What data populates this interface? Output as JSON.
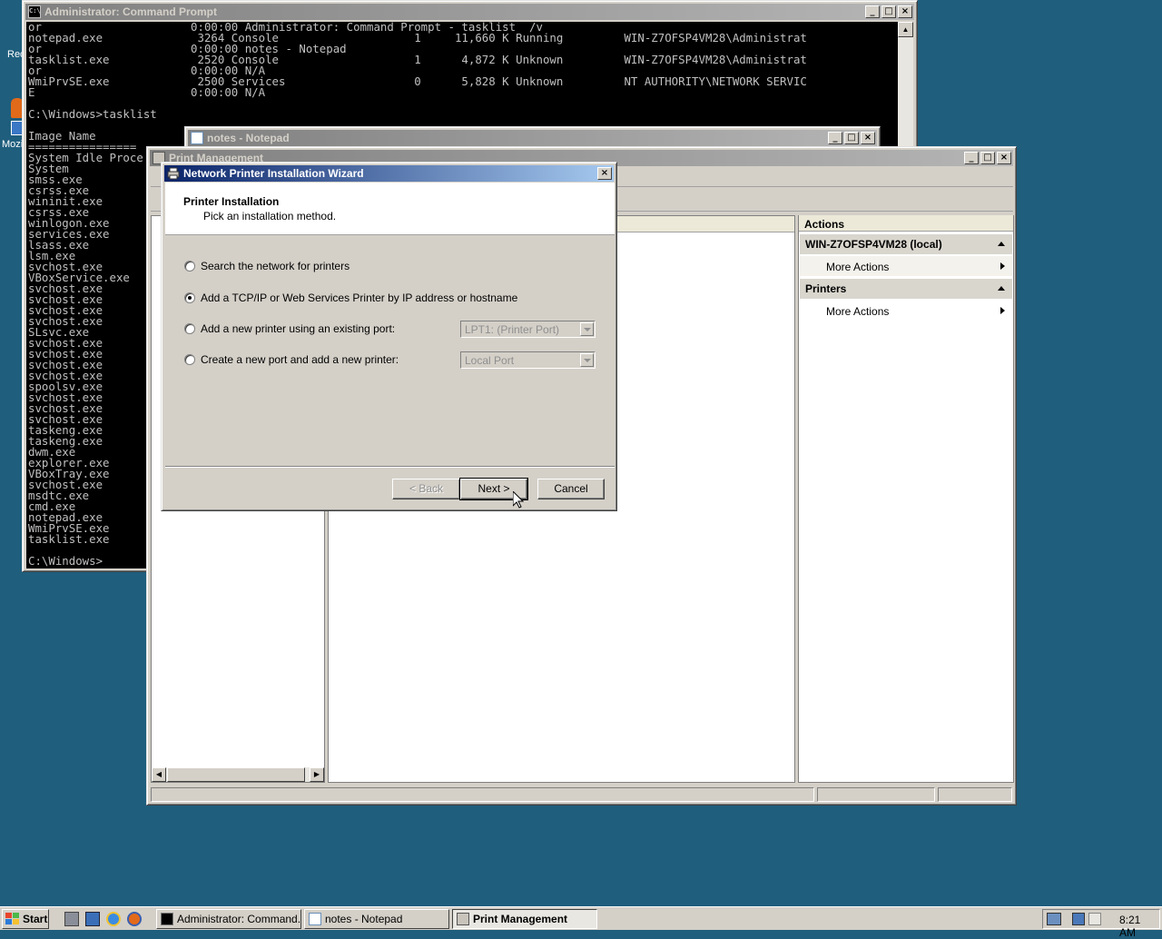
{
  "cmd": {
    "title": "Administrator: Command Prompt",
    "lines": [
      "or                      0:00:00 Administrator: Command Prompt - tasklist  /v",
      "notepad.exe              3264 Console                    1     11,660 K Running         WIN-Z7OFSP4VM28\\Administrat",
      "or                      0:00:00 notes - Notepad",
      "tasklist.exe             2520 Console                    1      4,872 K Unknown         WIN-Z7OFSP4VM28\\Administrat",
      "or                      0:00:00 N/A",
      "WmiPrvSE.exe             2500 Services                   0      5,828 K Unknown         NT AUTHORITY\\NETWORK SERVIC",
      "E                       0:00:00 N/A",
      "",
      "C:\\Windows>tasklist",
      "",
      "Image Name",
      "================",
      "System Idle Proce",
      "System",
      "smss.exe",
      "csrss.exe",
      "wininit.exe",
      "csrss.exe",
      "winlogon.exe",
      "services.exe",
      "lsass.exe",
      "lsm.exe",
      "svchost.exe",
      "VBoxService.exe",
      "svchost.exe",
      "svchost.exe",
      "svchost.exe",
      "svchost.exe",
      "SLsvc.exe",
      "svchost.exe",
      "svchost.exe",
      "svchost.exe",
      "svchost.exe",
      "spoolsv.exe",
      "svchost.exe",
      "svchost.exe",
      "svchost.exe",
      "taskeng.exe",
      "taskeng.exe",
      "dwm.exe",
      "explorer.exe",
      "VBoxTray.exe",
      "svchost.exe",
      "msdtc.exe",
      "cmd.exe",
      "notepad.exe",
      "WmiPrvSE.exe",
      "tasklist.exe",
      "",
      "C:\\Windows>"
    ]
  },
  "notepad": {
    "title": "notes - Notepad"
  },
  "print_management": {
    "title": "Print Management",
    "actions_header": "Actions",
    "sections": [
      {
        "label": "WIN-Z7OFSP4VM28 (local)",
        "item": "More Actions"
      },
      {
        "label": "Printers",
        "item": "More Actions"
      }
    ]
  },
  "wizard": {
    "title": "Network Printer Installation Wizard",
    "heading": "Printer Installation",
    "subheading": "Pick an installation method.",
    "options": [
      {
        "label": "Search the network for printers",
        "selected": false
      },
      {
        "label": "Add a TCP/IP or Web Services Printer by IP address or hostname",
        "selected": true
      },
      {
        "label": "Add a new printer using an existing port:",
        "selected": false,
        "combo": "LPT1: (Printer Port)"
      },
      {
        "label": "Create a new port and add a new printer:",
        "selected": false,
        "combo": "Local Port"
      }
    ],
    "buttons": {
      "back": "< Back",
      "next": "Next >",
      "cancel": "Cancel"
    }
  },
  "desktop": {
    "labels": [
      "Rec",
      "Mozi"
    ]
  },
  "taskbar": {
    "start": "Start",
    "tasks": [
      {
        "label": "Administrator: Command...",
        "active": false
      },
      {
        "label": "notes - Notepad",
        "active": false
      },
      {
        "label": "Print Management",
        "active": true
      }
    ],
    "clock": "8:21 AM"
  }
}
